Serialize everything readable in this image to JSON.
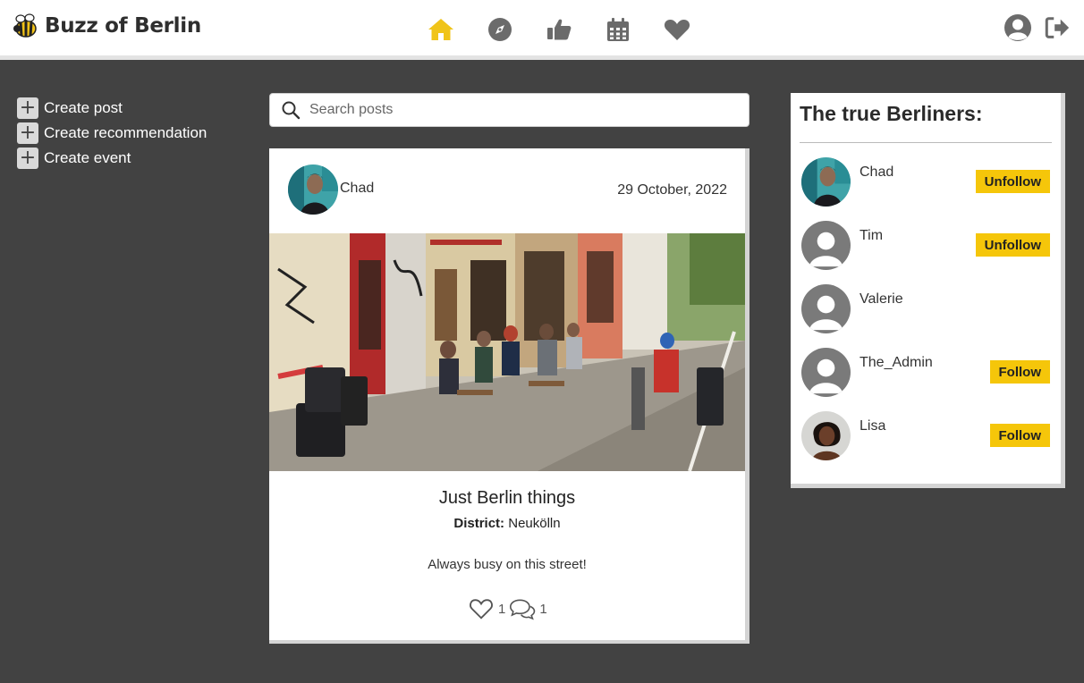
{
  "brand": {
    "name": "Buzz of Berlin",
    "logo_icon": "bee-icon"
  },
  "nav": {
    "items": [
      {
        "name": "home-icon",
        "active": true
      },
      {
        "name": "compass-icon",
        "active": false
      },
      {
        "name": "thumbs-up-icon",
        "active": false
      },
      {
        "name": "calendar-icon",
        "active": false
      },
      {
        "name": "heart-icon",
        "active": false
      }
    ],
    "right": [
      "user-avatar-icon",
      "sign-out-icon"
    ]
  },
  "sidebar": {
    "items": [
      {
        "label": "Create post"
      },
      {
        "label": "Create recommendation"
      },
      {
        "label": "Create event"
      }
    ]
  },
  "search": {
    "placeholder": "Search posts",
    "value": ""
  },
  "post": {
    "author": "Chad",
    "date": "29 October, 2022",
    "title": "Just Berlin things",
    "district_label": "District:",
    "district": "Neukölln",
    "body": "Always busy on this street!",
    "likes": "1",
    "comments": "1"
  },
  "profiles": {
    "title": "The true Berliners:",
    "list": [
      {
        "name": "Chad",
        "button": "Unfollow"
      },
      {
        "name": "Tim",
        "button": "Unfollow"
      },
      {
        "name": "Valerie",
        "button": ""
      },
      {
        "name": "The_Admin",
        "button": "Follow"
      },
      {
        "name": "Lisa",
        "button": "Follow"
      }
    ]
  },
  "colors": {
    "accent": "#f5c60a",
    "background": "#424242",
    "nav_active": "#f0c419",
    "nav_icon": "#6b6b6b"
  }
}
